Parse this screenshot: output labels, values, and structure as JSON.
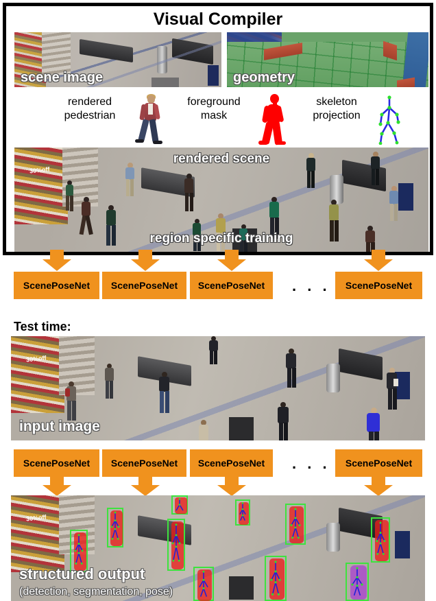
{
  "figure": {
    "title": "Visual Compiler",
    "test_time_label": "Test time:"
  },
  "top_panels": [
    {
      "name": "scene-image",
      "label": "scene image"
    },
    {
      "name": "geometry",
      "label": "geometry"
    }
  ],
  "legend": [
    {
      "name": "rendered-pedestrian",
      "line1": "rendered",
      "line2": "pedestrian",
      "icon": "pedestrian-render-icon"
    },
    {
      "name": "foreground-mask",
      "line1": "foreground",
      "line2": "mask",
      "icon": "red-silhouette-icon",
      "color": "#fe0000"
    },
    {
      "name": "skeleton-projection",
      "line1": "skeleton",
      "line2": "projection",
      "icon": "stick-skeleton-icon",
      "bone_color": "#2a2ae0",
      "joint_color": "#2ee02e"
    }
  ],
  "rendered_scene": {
    "label_top": "rendered scene",
    "label_bottom": "region specific training",
    "shop_sign": "30%off"
  },
  "networks_train": {
    "boxes": [
      "ScenePoseNet",
      "ScenePoseNet",
      "ScenePoseNet",
      "ScenePoseNet"
    ],
    "ellipsis": ". . .",
    "box_color": "#F0921E",
    "arrow_color": "#F0921E"
  },
  "input_image": {
    "label": "input image",
    "shop_sign": "30%off"
  },
  "networks_test": {
    "boxes": [
      "ScenePoseNet",
      "ScenePoseNet",
      "ScenePoseNet",
      "ScenePoseNet"
    ],
    "ellipsis": ". . ."
  },
  "structured_output": {
    "label": "structured output",
    "sublabel": "(detection, segmentation, pose)",
    "detection_box_color": "#3ee23e",
    "segmentation_color": "#eb1e19",
    "pose_bone_color": "#2020d8"
  }
}
